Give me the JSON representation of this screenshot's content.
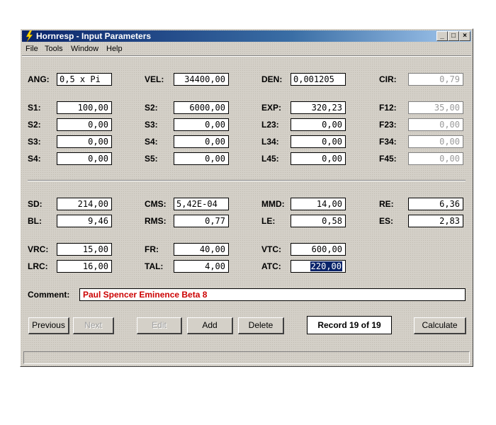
{
  "window": {
    "title": "Hornresp - Input Parameters"
  },
  "menu": [
    "File",
    "Tools",
    "Window",
    "Help"
  ],
  "params": {
    "ANG": {
      "label": "ANG:",
      "value": "0,5 x Pi"
    },
    "VEL": {
      "label": "VEL:",
      "value": "34400,00"
    },
    "DEN": {
      "label": "DEN:",
      "value": "0,001205"
    },
    "CIR": {
      "label": "CIR:",
      "value": "0,79"
    },
    "S1": {
      "label": "S1:",
      "value": "100,00"
    },
    "S2a": {
      "label": "S2:",
      "value": "6000,00"
    },
    "EXP": {
      "label": "EXP:",
      "value": "320,23"
    },
    "F12": {
      "label": "F12:",
      "value": "35,00"
    },
    "S2b": {
      "label": "S2:",
      "value": "0,00"
    },
    "S3a": {
      "label": "S3:",
      "value": "0,00"
    },
    "L23": {
      "label": "L23:",
      "value": "0,00"
    },
    "F23": {
      "label": "F23:",
      "value": "0,00"
    },
    "S3b": {
      "label": "S3:",
      "value": "0,00"
    },
    "S4a": {
      "label": "S4:",
      "value": "0,00"
    },
    "L34": {
      "label": "L34:",
      "value": "0,00"
    },
    "F34": {
      "label": "F34:",
      "value": "0,00"
    },
    "S4b": {
      "label": "S4:",
      "value": "0,00"
    },
    "S5": {
      "label": "S5:",
      "value": "0,00"
    },
    "L45": {
      "label": "L45:",
      "value": "0,00"
    },
    "F45": {
      "label": "F45:",
      "value": "0,00"
    },
    "SD": {
      "label": "SD:",
      "value": "214,00"
    },
    "CMS": {
      "label": "CMS:",
      "value": "5,42E-04"
    },
    "MMD": {
      "label": "MMD:",
      "value": "14,00"
    },
    "RE": {
      "label": "RE:",
      "value": "6,36"
    },
    "BL": {
      "label": "BL:",
      "value": "9,46"
    },
    "RMS": {
      "label": "RMS:",
      "value": "0,77"
    },
    "LE": {
      "label": "LE:",
      "value": "0,58"
    },
    "ES": {
      "label": "ES:",
      "value": "2,83"
    },
    "VRC": {
      "label": "VRC:",
      "value": "15,00"
    },
    "FR": {
      "label": "FR:",
      "value": "40,00"
    },
    "VTC": {
      "label": "VTC:",
      "value": "600,00"
    },
    "LRC": {
      "label": "LRC:",
      "value": "16,00"
    },
    "TAL": {
      "label": "TAL:",
      "value": "4,00"
    },
    "ATC": {
      "label": "ATC:",
      "value": "220,00"
    }
  },
  "comment": {
    "label": "Comment:",
    "value": "Paul Spencer Eminence Beta 8"
  },
  "buttons": {
    "previous": "Previous",
    "next": "Next",
    "edit": "Edit",
    "add": "Add",
    "delete": "Delete",
    "calculate": "Calculate"
  },
  "record": "Record 19 of 19",
  "colors": {
    "title_start": "#0a246a",
    "comment_text": "#cc0000",
    "selection": "#0a246a"
  },
  "icons": {
    "app": "lightning-bolt-icon"
  }
}
